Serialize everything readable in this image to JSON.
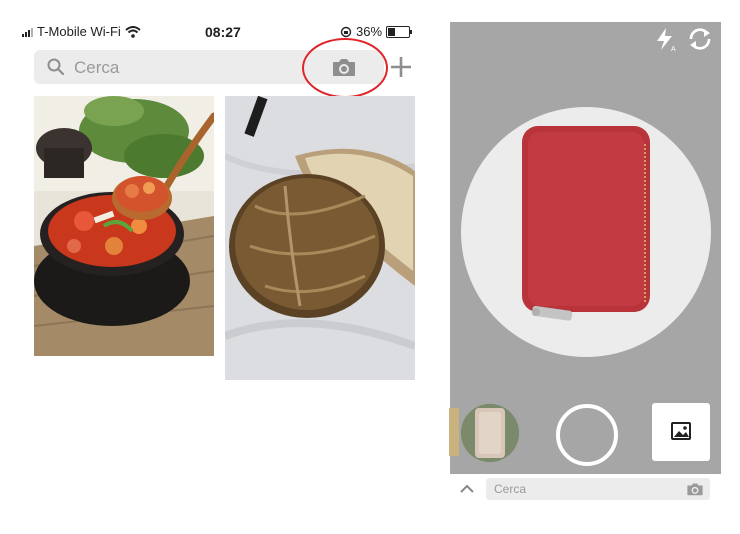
{
  "status_bar": {
    "carrier": "T-Mobile Wi-Fi",
    "time": "08:27",
    "battery_percent": "36%",
    "battery_level": 0.36
  },
  "search": {
    "placeholder": "Cerca"
  },
  "pins": [
    {
      "name": "soup-pin"
    },
    {
      "name": "bread-pin"
    }
  ],
  "camera": {
    "mini_search_placeholder": "Cerca"
  },
  "colors": {
    "highlight": "#e0252a",
    "wallet": "#b8343a",
    "camera_bg": "#a6a6a6"
  },
  "icons": [
    "search-icon",
    "camera-icon",
    "plus-icon",
    "flash-icon",
    "switch-camera-icon",
    "gallery-icon",
    "chevron-up-icon",
    "wifi-icon",
    "orientation-lock-icon",
    "battery-icon",
    "signal-icon"
  ]
}
